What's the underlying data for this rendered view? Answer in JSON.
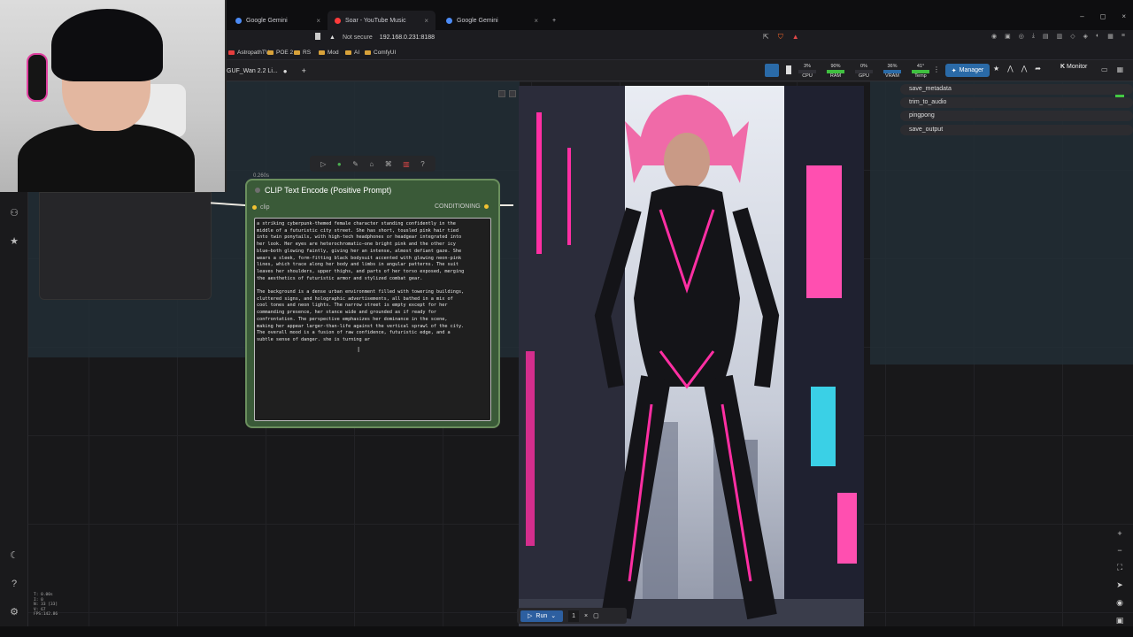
{
  "browser": {
    "tabs": [
      {
        "label": "Google Gemini",
        "color": "#4c8bf5"
      },
      {
        "label": "Soar - YouTube Music",
        "color": "#ff3b3b"
      },
      {
        "label": "Google Gemini",
        "color": "#4c8bf5"
      }
    ],
    "new_tab": "+",
    "window_controls": [
      "–",
      "◻",
      "×"
    ],
    "security_label": "Not secure",
    "url": "192.168.0.231:8188",
    "bookmarks": [
      "AstropathTV",
      "POE 2",
      "RS",
      "Mod",
      "AI",
      "ComfyUI"
    ]
  },
  "comfy": {
    "workflow_tab": "GUF_Wan 2.2 Li...",
    "add_tab": "+",
    "stats": [
      {
        "label": "CPU",
        "value": "3%",
        "color": "#4caf50"
      },
      {
        "label": "RAM",
        "value": "90%",
        "color": "#3fbf3f"
      },
      {
        "label": "GPU",
        "value": "0%",
        "color": "#4caf50"
      },
      {
        "label": "VRAM",
        "value": "36%",
        "color": "#2a6aa7"
      },
      {
        "label": "Temp",
        "value": "41°",
        "color": "#3fbf3f"
      }
    ],
    "manager_label": "Manager",
    "monitor_label": "Monitor"
  },
  "node": {
    "timing": "0.260s",
    "title": "CLIP Text Encode (Positive Prompt)",
    "input_label": "clip",
    "output_label": "CONDITIONING",
    "prompt": "a striking cyberpunk-themed female character standing confidently in the\nmiddle of a futuristic city street. She has short, tousled pink hair tied\ninto twin ponytails, with high-tech headphones or headgear integrated into\nher look. Her eyes are heterochromatic—one bright pink and the other icy\nblue—both glowing faintly, giving her an intense, almost defiant gaze. She\nwears a sleek, form-fitting black bodysuit accented with glowing neon-pink\nlines, which trace along her body and limbs in angular patterns. The suit\nleaves her shoulders, upper thighs, and parts of her torso exposed, merging\nthe aesthetics of futuristic armor and stylized combat gear.\n\nThe background is a dense urban environment filled with towering buildings,\ncluttered signs, and holographic advertisements, all bathed in a mix of\ncool tones and neon lights. The narrow street is empty except for her\ncommanding presence, her stance wide and grounded as if ready for\nconfrontation. The perspective emphasizes her dominance in the scene,\nmaking her appear larger-than-life against the vertical sprawl of the city.\nThe overall mood is a fusion of raw confidence, futuristic edge, and a\nsubtle sense of danger. she is turning ar"
  },
  "right_list": [
    "save_metadata",
    "trim_to_audio",
    "pingpong",
    "save_output"
  ],
  "runbar": {
    "run_label": "Run",
    "queue_count": "1"
  },
  "stats_corner": "T: 0.00s\nI: 0\nN: 33 [33]\nV: 67\nFPS:142.86",
  "icons": {
    "side_top": "model-library-icon",
    "side_star": "star-icon",
    "side_moon": "theme-toggle-icon",
    "side_help": "help-icon",
    "side_gear": "settings-icon"
  }
}
